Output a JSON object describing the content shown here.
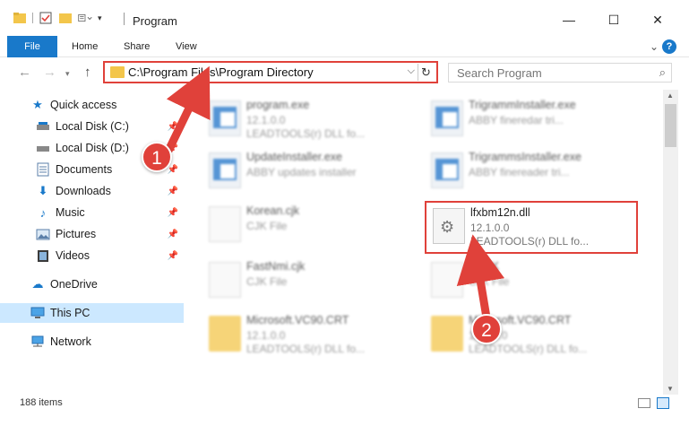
{
  "window": {
    "title": "Program",
    "minimize_glyph": "—",
    "maximize_glyph": "☐",
    "close_glyph": "✕"
  },
  "ribbon": {
    "tabs": [
      "File",
      "Home",
      "Share",
      "View"
    ],
    "help_glyph": "?"
  },
  "address": {
    "path": "C:\\Program Files\\Program Directory"
  },
  "search": {
    "placeholder": "Search Program"
  },
  "nav": {
    "items": [
      {
        "label": "Quick access",
        "icon": "star-icon",
        "pinned": false
      },
      {
        "label": "Local Disk (C:)",
        "icon": "drive-icon",
        "pinned": true
      },
      {
        "label": "Local Disk (D:)",
        "icon": "drive-icon",
        "pinned": true
      },
      {
        "label": "Documents",
        "icon": "documents-icon",
        "pinned": true
      },
      {
        "label": "Downloads",
        "icon": "downloads-icon",
        "pinned": true
      },
      {
        "label": "Music",
        "icon": "music-icon",
        "pinned": true
      },
      {
        "label": "Pictures",
        "icon": "pictures-icon",
        "pinned": true
      },
      {
        "label": "Videos",
        "icon": "videos-icon",
        "pinned": true
      },
      {
        "label": "OneDrive",
        "icon": "cloud-icon",
        "pinned": false
      },
      {
        "label": "This PC",
        "icon": "computer-icon",
        "pinned": false
      },
      {
        "label": "Network",
        "icon": "network-icon",
        "pinned": false
      }
    ]
  },
  "files": [
    {
      "name": "program.exe",
      "meta1": "12.1.0.0",
      "meta2": "LEADTOOLS(r) DLL fo...",
      "type": "exe"
    },
    {
      "name": "TrigrammInstaller.exe",
      "meta1": "ABBY fineredar tri...",
      "meta2": "",
      "type": "exe"
    },
    {
      "name": "UpdateInstaller.exe",
      "meta1": "ABBY updates installer",
      "meta2": "",
      "type": "exe"
    },
    {
      "name": "TrigrammsInstaller.exe",
      "meta1": "ABBY finereader tri...",
      "meta2": "",
      "type": "exe"
    },
    {
      "name": "Korean.cjk",
      "meta1": "CJK File",
      "meta2": "",
      "type": "doc"
    },
    {
      "name": "lfxbm12n.dll",
      "meta1": "12.1.0.0",
      "meta2": "LEADTOOLS(r) DLL fo...",
      "type": "dll"
    },
    {
      "name": "FastNmi.cjk",
      "meta1": "CJK File",
      "meta2": "",
      "type": "doc"
    },
    {
      "name": "...CJK",
      "meta1": "CJK File",
      "meta2": "",
      "type": "doc"
    },
    {
      "name": "Microsoft.VC90.CRT",
      "meta1": "12.1.0.0",
      "meta2": "LEADTOOLS(r) DLL fo...",
      "type": "folder"
    },
    {
      "name": "Microsoft.VC90.CRT",
      "meta1": "12.1.0.0",
      "meta2": "LEADTOOLS(r) DLL fo...",
      "type": "folder"
    }
  ],
  "status": {
    "item_count": "188 items"
  },
  "annotations": {
    "badge1": "1",
    "badge2": "2",
    "color": "#e0413a"
  }
}
